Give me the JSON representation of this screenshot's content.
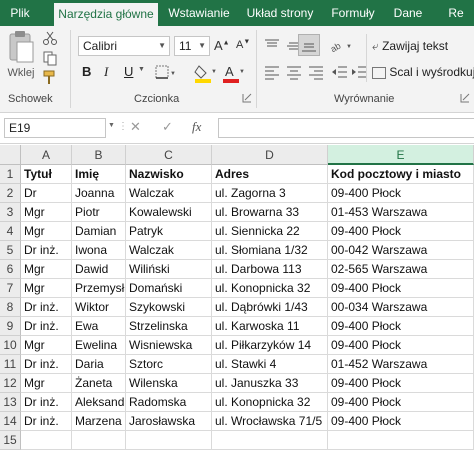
{
  "tabs": [
    "Plik",
    "Narzędzia główne",
    "Wstawianie",
    "Układ strony",
    "Formuły",
    "Dane",
    "Re"
  ],
  "active_tab": 1,
  "ribbon": {
    "clipboard_label": "Schowek",
    "paste_label": "Wklej",
    "font_label": "Czcionka",
    "font_name": "Calibri",
    "font_size": "11",
    "bold": "B",
    "italic": "I",
    "underline": "U",
    "alignment_label": "Wyrównanie",
    "wrap_text": "Zawijaj tekst",
    "merge_center": "Scal i wyśrodkuj",
    "font_color": "#e02020",
    "fill_color": "#ffd800"
  },
  "formula_bar": {
    "name_box": "E19",
    "cancel": "✕",
    "enter": "✓",
    "fx": "fx",
    "value": ""
  },
  "columns": [
    "A",
    "B",
    "C",
    "D",
    "E"
  ],
  "selected_column": "E",
  "headers": [
    "Tytuł",
    "Imię",
    "Nazwisko",
    "Adres",
    "Kod pocztowy i miasto"
  ],
  "rows": [
    [
      "Dr",
      "Joanna",
      "Walczak",
      "ul. Zagorna 3",
      "09-400 Płock"
    ],
    [
      "Mgr",
      "Piotr",
      "Kowalewski",
      "ul. Browarna 33",
      "01-453 Warszawa"
    ],
    [
      "Mgr",
      "Damian",
      "Patryk",
      "ul. Siennicka 22",
      "09-400 Płock"
    ],
    [
      "Dr inż.",
      "Iwona",
      "Walczak",
      "ul. Słomiana 1/32",
      "00-042 Warszawa"
    ],
    [
      "Mgr",
      "Dawid",
      "Wiliński",
      "ul. Darbowa 113",
      "02-565 Warszawa"
    ],
    [
      "Mgr",
      "Przemysław",
      "Domański",
      "ul. Konopnicka 32",
      "09-400 Płock"
    ],
    [
      "Dr inż.",
      "Wiktor",
      "Szykowski",
      "ul. Dąbrówki 1/43",
      "00-034 Warszawa"
    ],
    [
      "Dr inż.",
      "Ewa",
      "Strzelinska",
      "ul. Karwoska 11",
      "09-400 Płock"
    ],
    [
      "Mgr",
      "Ewelina",
      "Wisniewska",
      "ul. Piłkarzyków 14",
      "09-400 Płock"
    ],
    [
      "Dr inż.",
      "Daria",
      "Sztorc",
      "ul. Stawki 4",
      "01-452 Warszawa"
    ],
    [
      "Mgr",
      "Żaneta",
      "Wilenska",
      "ul. Januszka 33",
      "09-400 Płock"
    ],
    [
      "Dr inż.",
      "Aleksandra",
      "Radomska",
      "ul. Konopnicka 32",
      "09-400 Płock"
    ],
    [
      "Dr inż.",
      "Marzena",
      "Jarosławska",
      "ul. Wrocławska 71/5",
      "09-400 Płock"
    ]
  ],
  "row_numbers": [
    "1",
    "2",
    "3",
    "4",
    "5",
    "6",
    "7",
    "8",
    "9",
    "10",
    "11",
    "12",
    "13",
    "14",
    "15"
  ]
}
